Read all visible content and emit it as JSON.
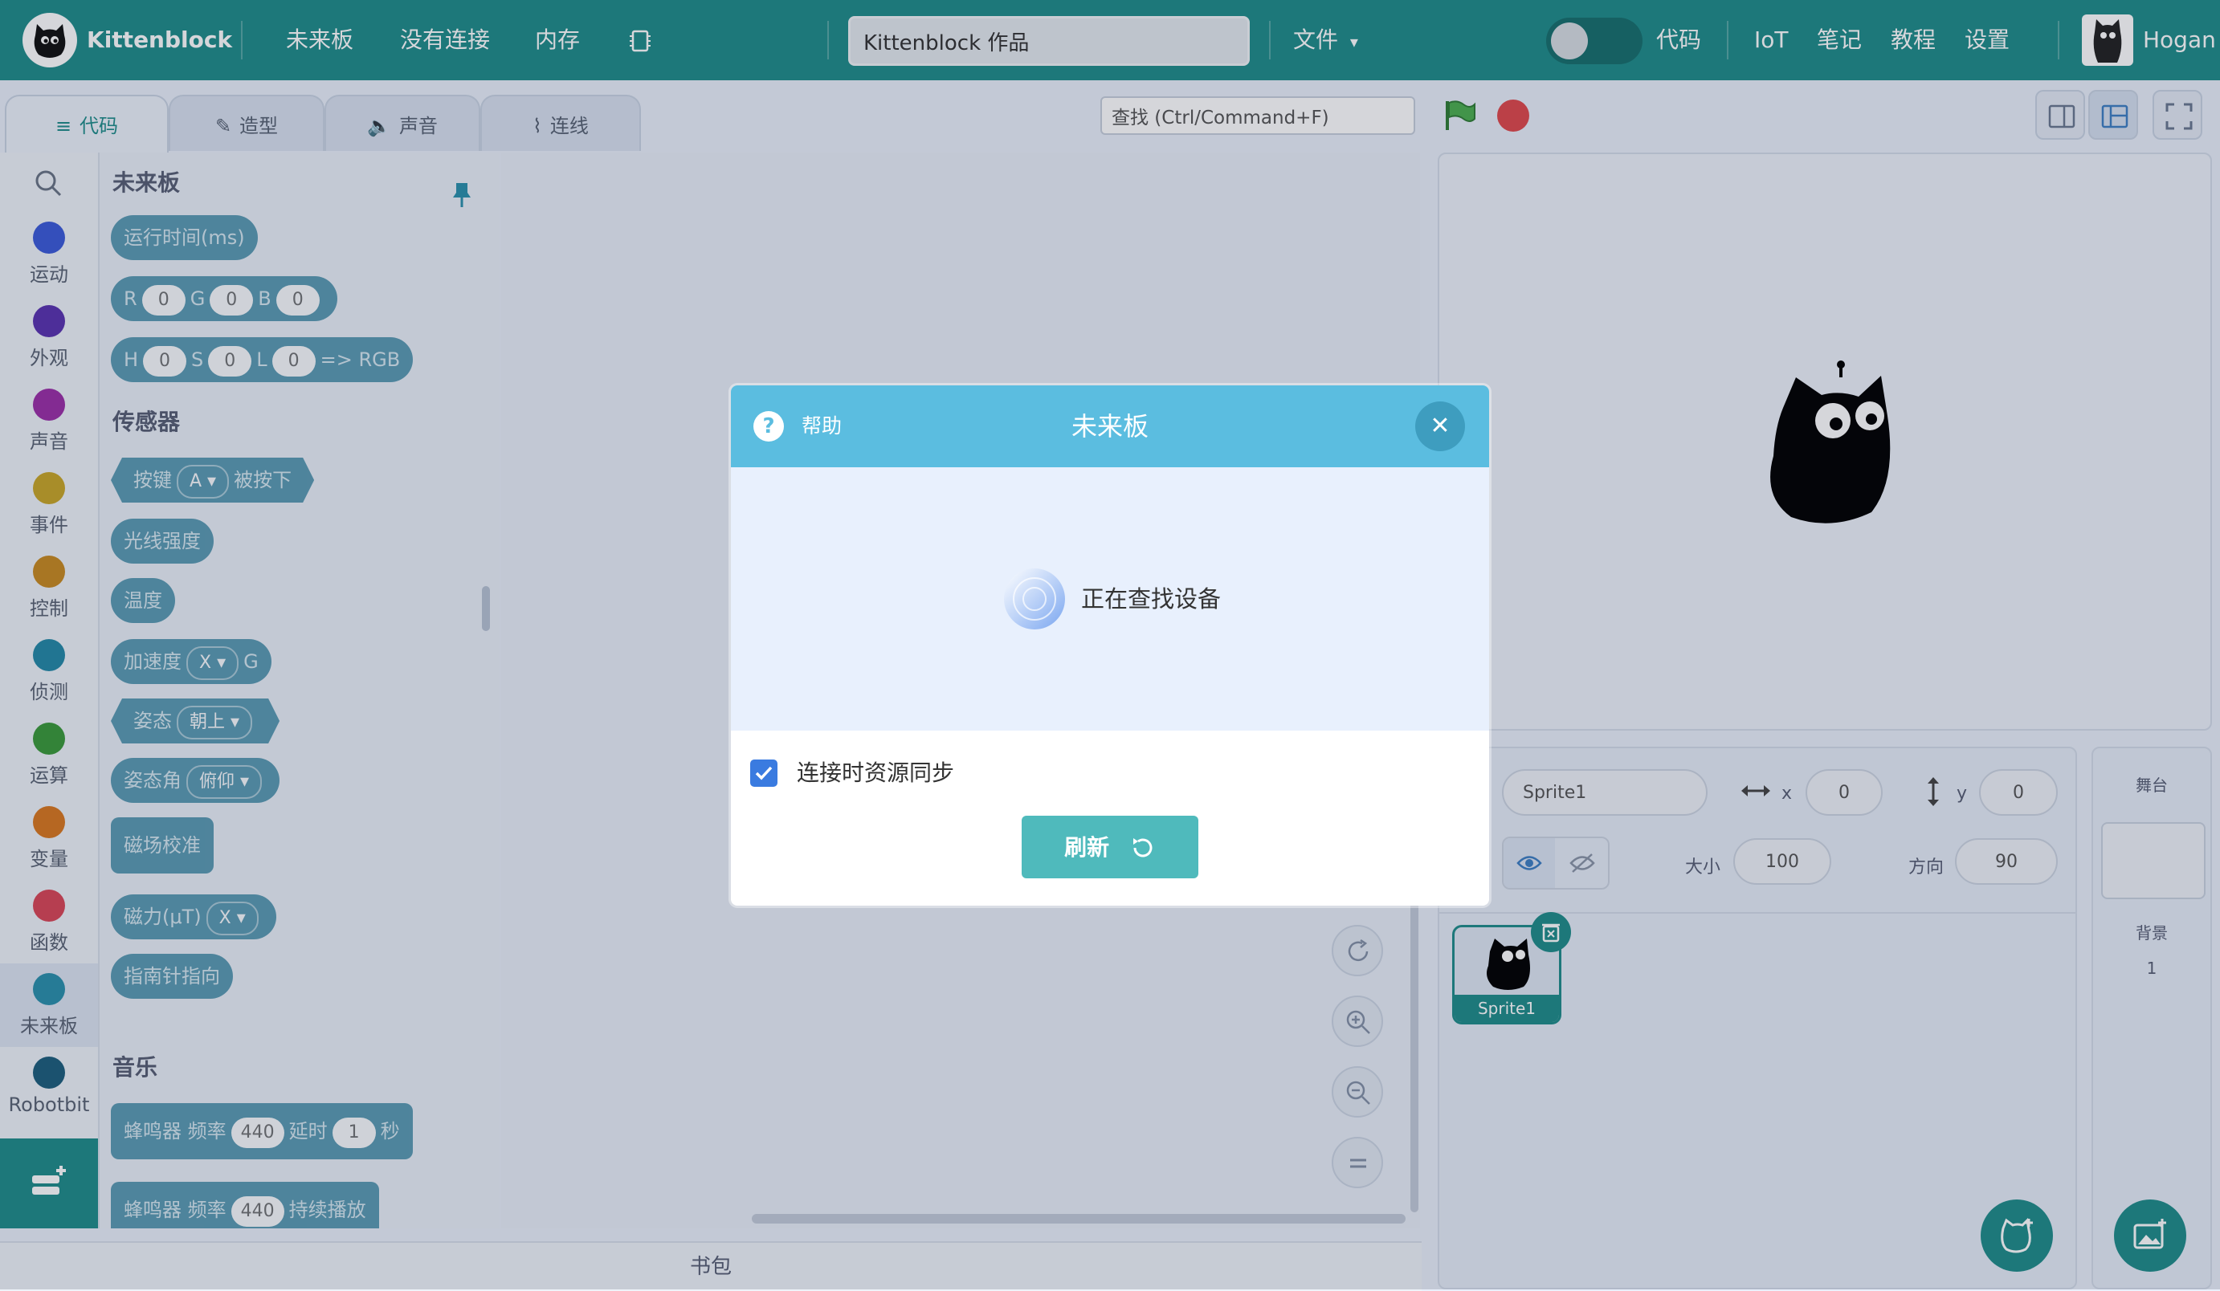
{
  "topbar": {
    "brand": "Kittenblock",
    "menu": [
      "未来板",
      "没有连接",
      "内存"
    ],
    "project_title": "Kittenblock 作品",
    "file_menu": "文件",
    "code_toggle_label": "代码",
    "right_menu": [
      "IoT",
      "笔记",
      "教程",
      "设置"
    ],
    "username": "Hogan"
  },
  "tabs": [
    "代码",
    "造型",
    "声音",
    "连线"
  ],
  "search": {
    "placeholder": "查找 (Ctrl/Command+F)"
  },
  "categories": [
    {
      "label": "运动",
      "color": "#3b5bd9"
    },
    {
      "label": "外观",
      "color": "#5a33b0"
    },
    {
      "label": "声音",
      "color": "#9b2fa8"
    },
    {
      "label": "事件",
      "color": "#c9a628"
    },
    {
      "label": "控制",
      "color": "#c98a20"
    },
    {
      "label": "侦测",
      "color": "#2489a8"
    },
    {
      "label": "运算",
      "color": "#3a9a3a"
    },
    {
      "label": "变量",
      "color": "#d9781f"
    },
    {
      "label": "函数",
      "color": "#d94657"
    },
    {
      "label": "未来板",
      "color": "#2a90ad"
    },
    {
      "label": "Robotbit",
      "color": "#1d5f7d"
    }
  ],
  "palette": {
    "section1": "未来板",
    "runtime": "运行时间(ms)",
    "rgb": {
      "r": "R",
      "g": "G",
      "b": "B",
      "rv": "0",
      "gv": "0",
      "bv": "0"
    },
    "hsl": {
      "h": "H",
      "s": "S",
      "l": "L",
      "hv": "0",
      "sv": "0",
      "lv": "0",
      "tail": "=> RGB"
    },
    "section2": "传感器",
    "button": {
      "a": "按键",
      "key": "A",
      "b": "被按下"
    },
    "light": "光线强度",
    "temp": "温度",
    "accel": {
      "a": "加速度",
      "axis": "X",
      "unit": "G"
    },
    "posture": {
      "a": "姿态",
      "dir": "朝上"
    },
    "angle": {
      "a": "姿态角",
      "dir": "俯仰"
    },
    "calibrate": "磁场校准",
    "magnetic": {
      "a": "磁力(μT)",
      "axis": "X"
    },
    "compass": "指南针指向",
    "section3": "音乐",
    "buzzer1": {
      "a": "蜂鸣器 频率",
      "freq": "440",
      "b": "延时",
      "dur": "1",
      "c": "秒"
    },
    "buzzer2": {
      "a": "蜂鸣器 频率",
      "freq": "440",
      "b": "持续播放"
    }
  },
  "backpack": "书包",
  "sprite": {
    "name": "Sprite1",
    "x_label": "x",
    "x": "0",
    "y_label": "y",
    "y": "0",
    "size_label": "大小",
    "size": "100",
    "dir_label": "方向",
    "dir": "90",
    "thumb_name": "Sprite1"
  },
  "stage_pane": {
    "header": "舞台",
    "bg_label": "背景",
    "bg_count": "1"
  },
  "modal": {
    "help": "帮助",
    "title": "未来板",
    "status": "正在查找设备",
    "sync_label": "连接时资源同步",
    "refresh": "刷新"
  }
}
